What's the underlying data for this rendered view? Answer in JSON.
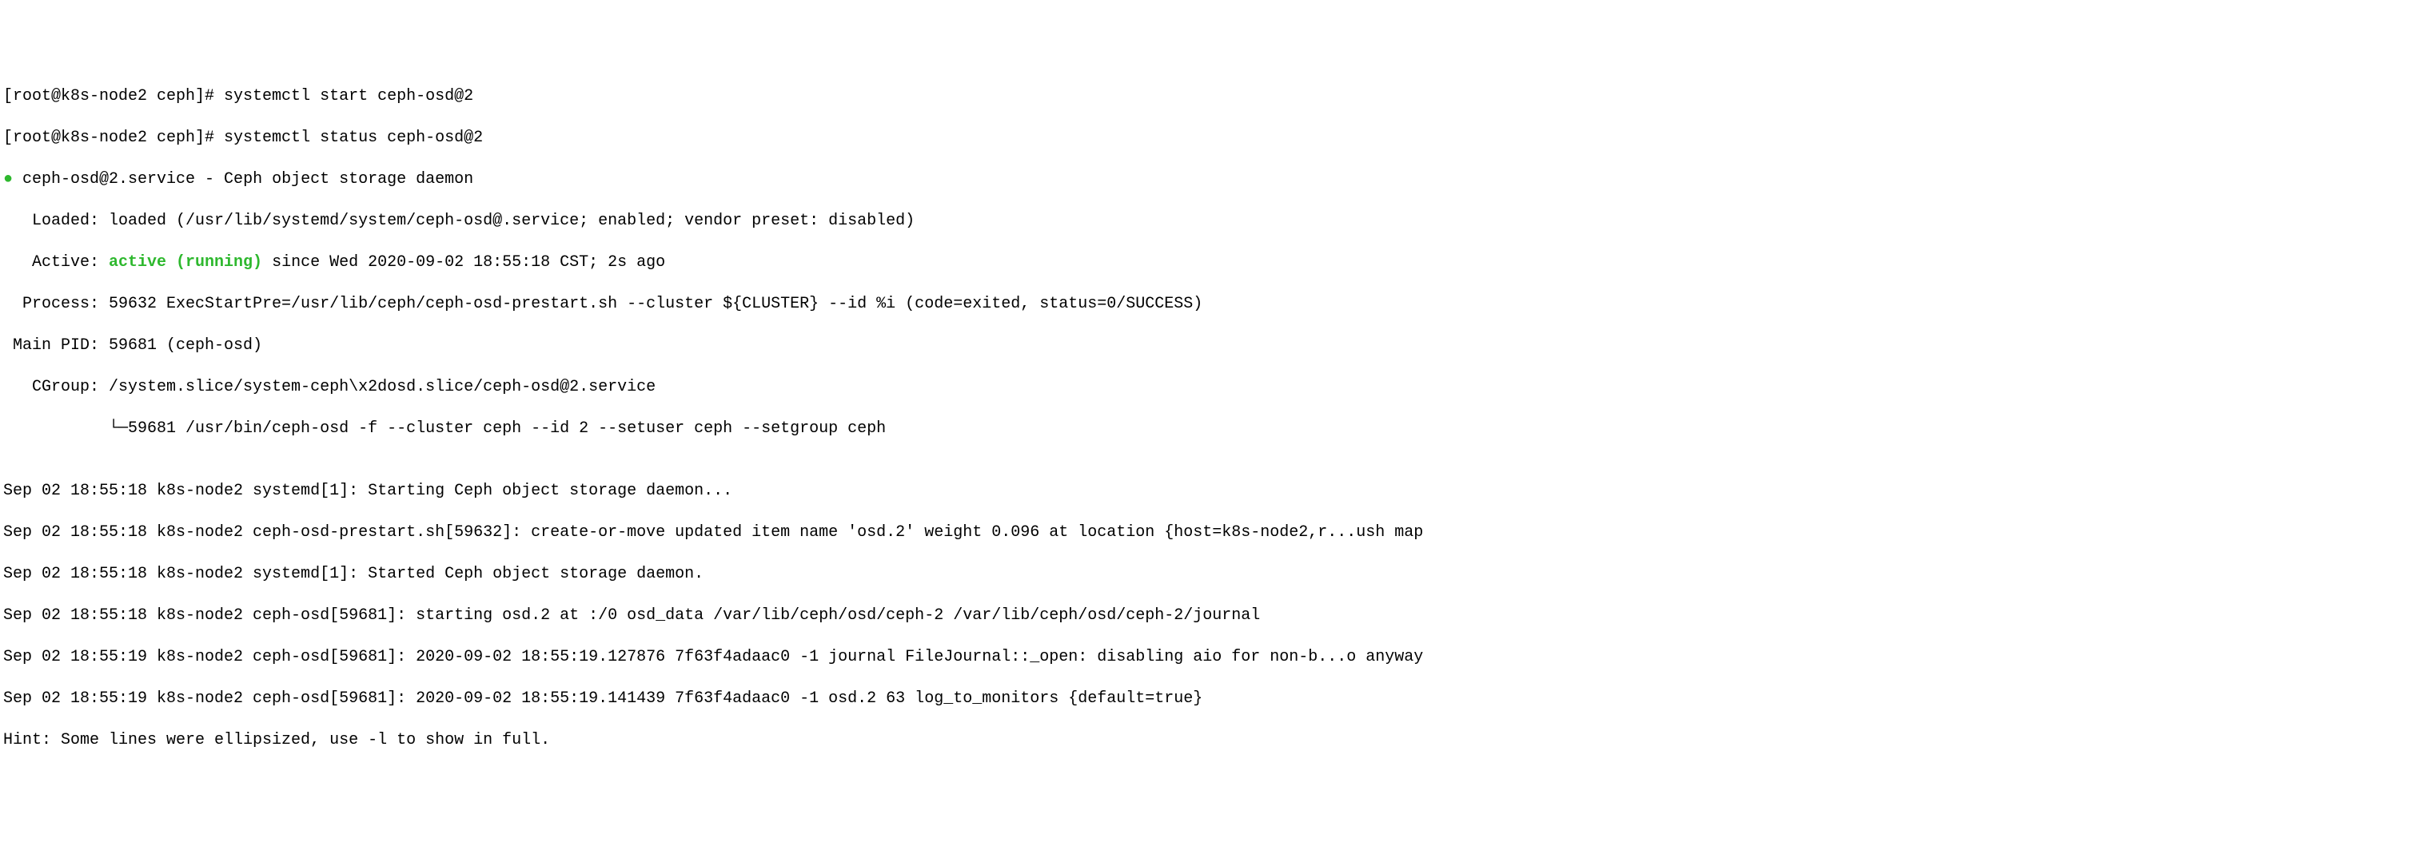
{
  "prompt1": "[root@k8s-node2 ceph]# ",
  "cmd1": "systemctl start ceph-osd@2",
  "prompt2": "[root@k8s-node2 ceph]# ",
  "cmd2": "systemctl status ceph-osd@2",
  "dot": "●",
  "service_line": " ceph-osd@2.service - Ceph object storage daemon",
  "loaded_line": "   Loaded: loaded (/usr/lib/systemd/system/ceph-osd@.service; enabled; vendor preset: disabled)",
  "active_prefix": "   Active: ",
  "active_status": "active (running)",
  "active_suffix": " since Wed 2020-09-02 18:55:18 CST; 2s ago",
  "process_line": "  Process: 59632 ExecStartPre=/usr/lib/ceph/ceph-osd-prestart.sh --cluster ${CLUSTER} --id %i (code=exited, status=0/SUCCESS)",
  "mainpid_line": " Main PID: 59681 (ceph-osd)",
  "cgroup_line": "   CGroup: /system.slice/system-ceph\\x2dosd.slice/ceph-osd@2.service",
  "cgroup_child": "           └─59681 /usr/bin/ceph-osd -f --cluster ceph --id 2 --setuser ceph --setgroup ceph",
  "blank": "",
  "log1": "Sep 02 18:55:18 k8s-node2 systemd[1]: Starting Ceph object storage daemon...",
  "log2": "Sep 02 18:55:18 k8s-node2 ceph-osd-prestart.sh[59632]: create-or-move updated item name 'osd.2' weight 0.096 at location {host=k8s-node2,r...ush map",
  "log3": "Sep 02 18:55:18 k8s-node2 systemd[1]: Started Ceph object storage daemon.",
  "log4": "Sep 02 18:55:18 k8s-node2 ceph-osd[59681]: starting osd.2 at :/0 osd_data /var/lib/ceph/osd/ceph-2 /var/lib/ceph/osd/ceph-2/journal",
  "log5": "Sep 02 18:55:19 k8s-node2 ceph-osd[59681]: 2020-09-02 18:55:19.127876 7f63f4adaac0 -1 journal FileJournal::_open: disabling aio for non-b...o anyway",
  "log6": "Sep 02 18:55:19 k8s-node2 ceph-osd[59681]: 2020-09-02 18:55:19.141439 7f63f4adaac0 -1 osd.2 63 log_to_monitors {default=true}",
  "hint": "Hint: Some lines were ellipsized, use -l to show in full."
}
